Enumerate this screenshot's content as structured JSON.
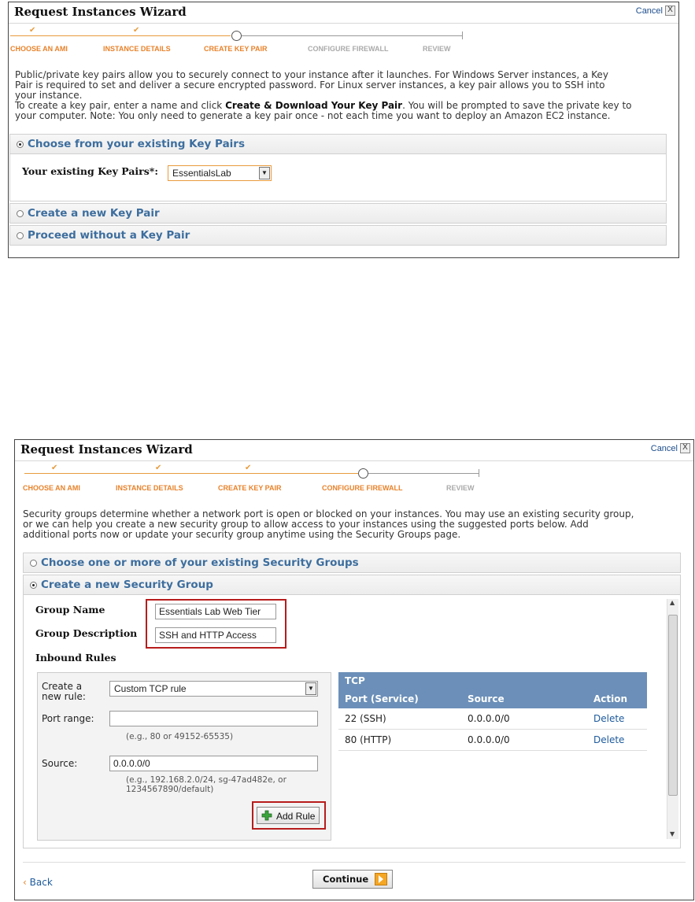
{
  "wizard1": {
    "title": "Request Instances Wizard",
    "cancel": "Cancel",
    "close_glyph": "X",
    "steps": [
      "CHOOSE AN AMI",
      "INSTANCE DETAILS",
      "CREATE KEY PAIR",
      "CONFIGURE FIREWALL",
      "REVIEW"
    ],
    "description_line1": "Public/private key pairs allow you to securely connect to your instance after it launches. For Windows Server instances, a Key",
    "description_line2": "Pair is required to set and deliver a secure encrypted password. For Linux server instances, a key pair allows you to SSH into",
    "description_line3": "your instance.",
    "description_line4_pre": "To create a key pair, enter a name and click ",
    "description_line4_bold": "Create & Download Your Key Pair",
    "description_line4_post": ". You will be prompted to save the private key to",
    "description_line5": "your computer. Note: You only need to generate a key pair once - not each time you want to deploy an Amazon EC2 instance.",
    "option_existing": "Choose from your existing Key Pairs",
    "existing_label": "Your existing Key Pairs*:",
    "existing_value": "EssentialsLab",
    "option_create": "Create a new Key Pair",
    "option_none": "Proceed without a Key Pair"
  },
  "wizard2": {
    "title": "Request Instances Wizard",
    "cancel": "Cancel",
    "close_glyph": "X",
    "steps": [
      "CHOOSE AN AMI",
      "INSTANCE DETAILS",
      "CREATE KEY PAIR",
      "CONFIGURE FIREWALL",
      "REVIEW"
    ],
    "description_line1": "Security groups determine whether a network port is open or blocked on your instances. You may use an existing security group,",
    "description_line2": "or we can help you create a new security group to allow access to your instances using the suggested ports below. Add",
    "description_line3": "additional ports now or update your security group anytime using the Security Groups page.",
    "option_existing": "Choose one or more of your existing Security Groups",
    "option_create": "Create a new Security Group",
    "group_name_label": "Group Name",
    "group_name_value": "Essentials Lab Web Tier",
    "group_desc_label": "Group Description",
    "group_desc_value": "SSH and HTTP Access",
    "inbound_label": "Inbound Rules",
    "create_rule_label_1": "Create a",
    "create_rule_label_2": "new rule:",
    "rule_type_value": "Custom TCP rule",
    "port_range_label": "Port range:",
    "port_range_value": "",
    "port_range_hint": "(e.g., 80 or 49152-65535)",
    "source_label": "Source:",
    "source_value": "0.0.0.0/0",
    "source_hint_1": "(e.g., 192.168.2.0/24, sg-47ad482e, or",
    "source_hint_2": "1234567890/default)",
    "add_rule": "Add Rule",
    "table_title": "TCP",
    "table_headers": [
      "Port (Service)",
      "Source",
      "Action"
    ],
    "table_rows": [
      {
        "port": "22 (SSH)",
        "source": "0.0.0.0/0",
        "action": "Delete"
      },
      {
        "port": "80 (HTTP)",
        "source": "0.0.0.0/0",
        "action": "Delete"
      }
    ],
    "back": "Back",
    "continue": "Continue"
  },
  "colors": {
    "accent_orange": "#e8822a",
    "link_blue": "#1c5a9c",
    "section_title": "#3d6e9e",
    "table_header": "#6b8fb8",
    "highlight_red": "#b71c1c"
  }
}
